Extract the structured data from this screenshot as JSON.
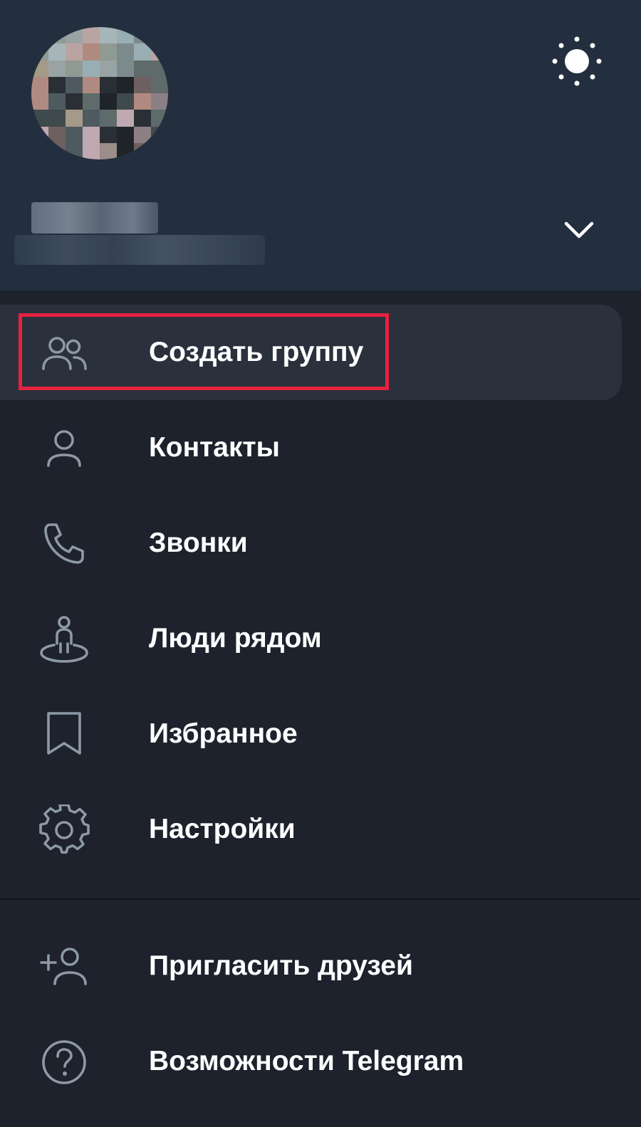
{
  "header": {
    "avatar_alt": "",
    "theme_icon": "sun-icon",
    "expand_icon": "chevron-down-icon"
  },
  "menu": {
    "items": [
      {
        "label": "Создать группу",
        "icon": "group-icon"
      },
      {
        "label": "Контакты",
        "icon": "person-icon"
      },
      {
        "label": "Звонки",
        "icon": "phone-icon"
      },
      {
        "label": "Люди рядом",
        "icon": "people-nearby-icon"
      },
      {
        "label": "Избранное",
        "icon": "bookmark-icon"
      },
      {
        "label": "Настройки",
        "icon": "gear-icon"
      }
    ],
    "secondary": [
      {
        "label": "Пригласить друзей",
        "icon": "add-user-icon"
      },
      {
        "label": "Возможности Telegram",
        "icon": "help-icon"
      }
    ]
  },
  "colors": {
    "header_bg": "#232f3e",
    "drawer_bg": "#1d222c",
    "highlight": "#e8213f",
    "icon": "#8d99a6",
    "label": "#ffffff"
  }
}
